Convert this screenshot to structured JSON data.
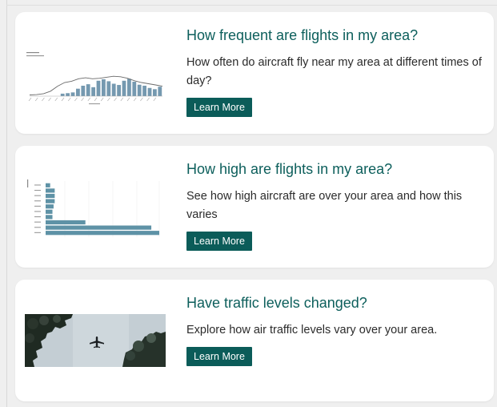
{
  "colors": {
    "accent": "#0d5f5c",
    "button_bg": "#0b5c59",
    "chart_bar": "#7599b0",
    "chart_bar_horizontal": "#5e92a6",
    "card_bg": "#ffffff",
    "page_bg": "#efefef"
  },
  "cards": [
    {
      "title": "How frequent are flights in my area?",
      "description": "How often do aircraft fly near my area at different times of day?",
      "button_label": "Learn More"
    },
    {
      "title": "How high are flights in my area?",
      "description": "See how high aircraft are over your area and how this varies",
      "button_label": "Learn More"
    },
    {
      "title": "Have traffic levels changed?",
      "description": "Explore how air traffic levels vary over your area.",
      "button_label": "Learn More"
    }
  ],
  "thumbnails": {
    "frequency_chart": {
      "bars": [
        0.1,
        0.12,
        0.15,
        0.3,
        0.42,
        0.48,
        0.36,
        0.62,
        0.68,
        0.6,
        0.5,
        0.45,
        0.62,
        0.7,
        0.58,
        0.46,
        0.42,
        0.33,
        0.28,
        0.38
      ],
      "line": [
        0.05,
        0.06,
        0.1,
        0.2,
        0.4,
        0.55,
        0.6,
        0.7,
        0.74,
        0.7,
        0.72,
        0.76,
        0.8,
        0.78,
        0.72,
        0.62,
        0.55,
        0.5,
        0.45,
        0.4
      ]
    },
    "altitude_chart": {
      "bars": [
        0.04,
        0.08,
        0.08,
        0.08,
        0.07,
        0.06,
        0.06,
        0.35,
        0.93,
        1.0
      ]
    },
    "photo": {
      "icon": "airplane-icon",
      "sky_color": "#c4ced4"
    }
  }
}
